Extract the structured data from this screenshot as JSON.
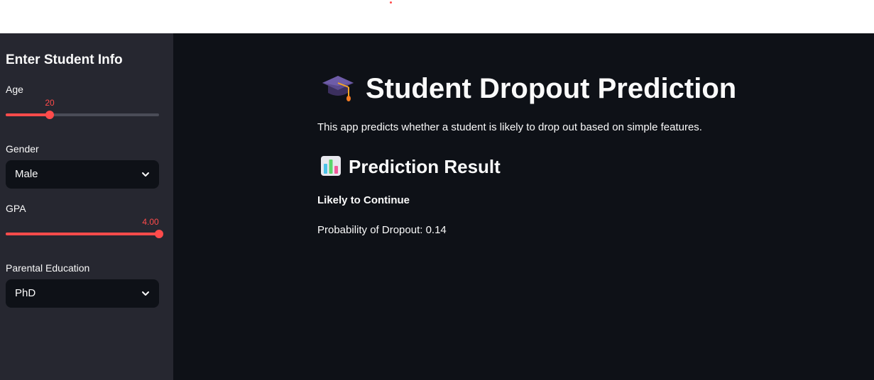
{
  "sidebar": {
    "title": "Enter Student Info",
    "age": {
      "label": "Age",
      "value": "20",
      "fraction": 0.286
    },
    "gender": {
      "label": "Gender",
      "selected": "Male"
    },
    "gpa": {
      "label": "GPA",
      "value": "4.00",
      "fraction": 1.0
    },
    "parental_education": {
      "label": "Parental Education",
      "selected": "PhD"
    }
  },
  "main": {
    "title_icon": "graduation-cap-icon",
    "title": "Student Dropout Prediction",
    "description": "This app predicts whether a student is likely to drop out based on simple features.",
    "section_icon": "bar-chart-icon",
    "section_title": "Prediction Result",
    "result": "Likely to Continue",
    "probability": "Probability of Dropout: 0.14"
  },
  "colors": {
    "accent": "#ff4b4b",
    "sidebar_bg": "#262730",
    "main_bg": "#0e1117",
    "text": "#fafafa"
  }
}
